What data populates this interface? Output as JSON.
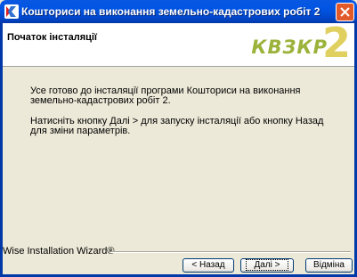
{
  "window": {
    "title": "Кошториси на виконання земельно-кадастрових робіт 2"
  },
  "header": {
    "title": "Початок інсталяції",
    "logo_text": "КВЗКР",
    "logo_digit": "2"
  },
  "content": {
    "paragraph1": "Усе готово до інсталяції програми Кошториси на виконання земельно-кадастрових робіт 2.",
    "paragraph2": "Натисніть кнопку Далі > для запуску інсталяції або кнопку Назад для зміни параметрів."
  },
  "footer": {
    "brand": "Wise Installation Wizard®"
  },
  "buttons": {
    "back": "< Назад",
    "next": "Далі >",
    "cancel": "Відміна"
  },
  "colors": {
    "titlebar": "#0054E3",
    "close": "#E35A2A",
    "logo_text": "#9BB23B",
    "logo_digit": "#E0D060"
  }
}
